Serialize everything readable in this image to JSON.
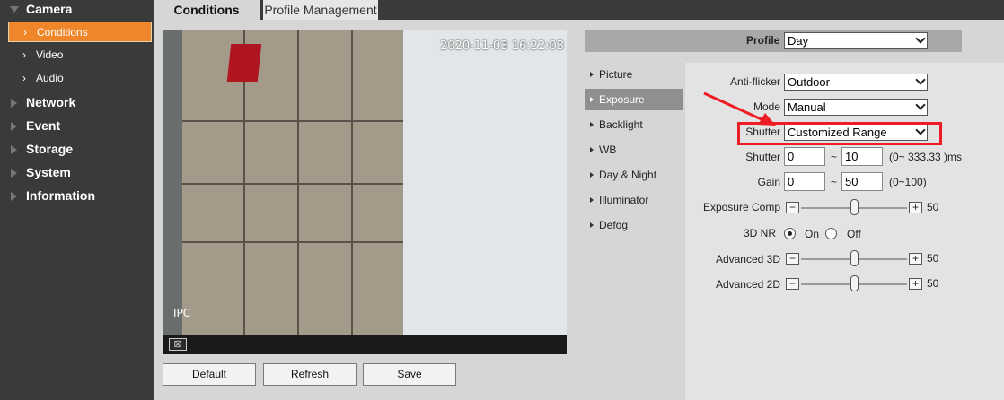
{
  "colors": {
    "accent": "#f0862a",
    "annotation": "#ee1c24",
    "sidebar": "#3a3a3a"
  },
  "sidebar": {
    "camera": "Camera",
    "sub": [
      "Conditions",
      "Video",
      "Audio"
    ],
    "items": [
      "Network",
      "Event",
      "Storage",
      "System",
      "Information"
    ]
  },
  "tabs": {
    "conditions": "Conditions",
    "profile_management": "Profile Management"
  },
  "video": {
    "timestamp": "2020-11-03 16:22:03",
    "channel_label": "IPC"
  },
  "buttons": {
    "default": "Default",
    "refresh": "Refresh",
    "save": "Save"
  },
  "profile": {
    "label": "Profile",
    "value": "Day"
  },
  "menu": [
    "Picture",
    "Exposure",
    "Backlight",
    "WB",
    "Day & Night",
    "Illuminator",
    "Defog"
  ],
  "form": {
    "anti_flicker": {
      "label": "Anti-flicker",
      "value": "Outdoor"
    },
    "mode": {
      "label": "Mode",
      "value": "Manual"
    },
    "shutter_select": {
      "label": "Shutter",
      "value": "Customized Range"
    },
    "shutter_range": {
      "label": "Shutter",
      "min": "0",
      "max": "10",
      "sep": "~",
      "hint": "(0~ 333.33 )ms"
    },
    "gain": {
      "label": "Gain",
      "min": "0",
      "max": "50",
      "sep": "~",
      "hint": "(0~100)"
    },
    "exposure_comp": {
      "label": "Exposure Comp",
      "value": "50",
      "level": 0.5
    },
    "nr3d": {
      "label": "3D NR",
      "on": "On",
      "off": "Off",
      "selected": "On"
    },
    "advanced_3d": {
      "label": "Advanced 3D",
      "value": "50",
      "level": 0.5
    },
    "advanced_2d": {
      "label": "Advanced 2D",
      "value": "50",
      "level": 0.5
    }
  },
  "slider_buttons": {
    "minus": "−",
    "plus": "+"
  }
}
